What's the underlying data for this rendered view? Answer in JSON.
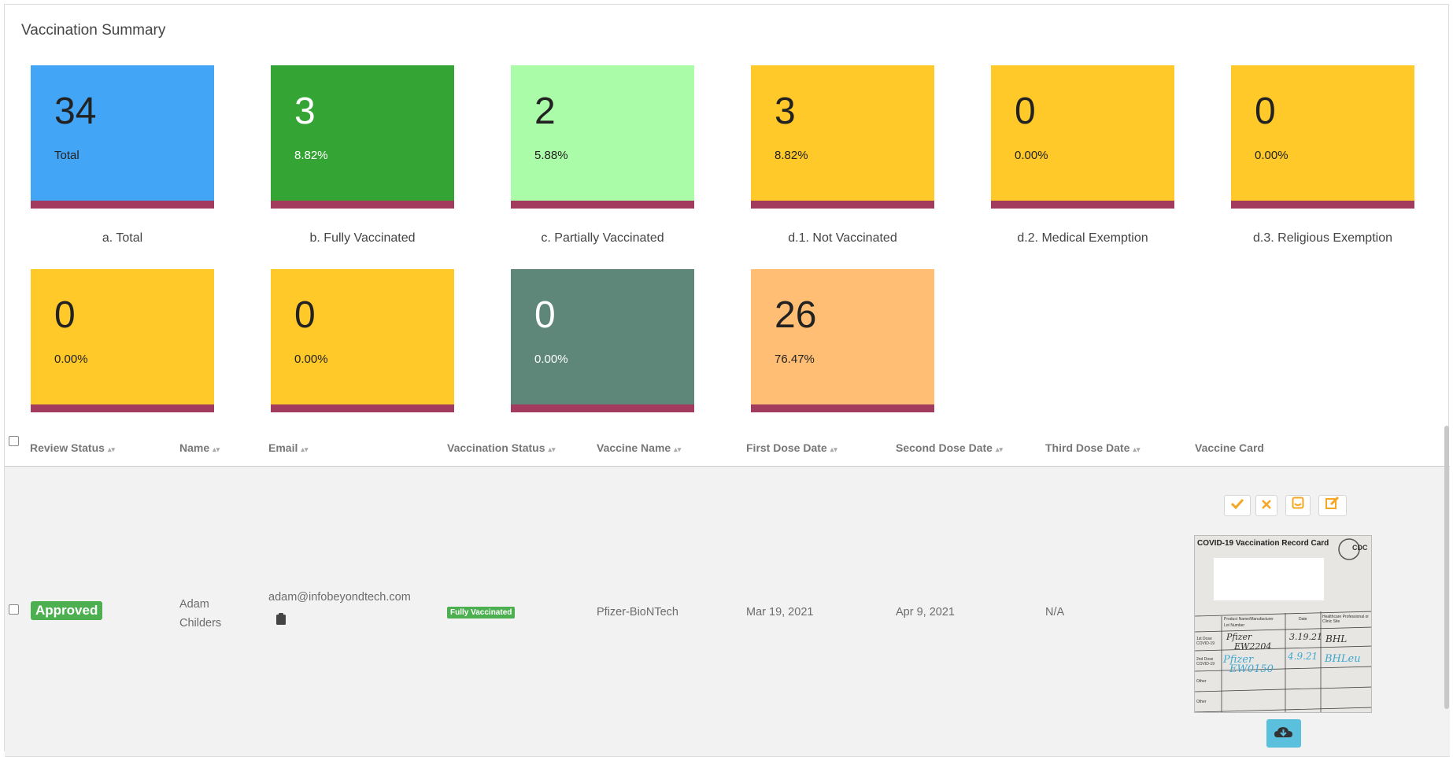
{
  "summary": {
    "title": "Vaccination Summary",
    "tiles": [
      {
        "number": "34",
        "sub": "Total",
        "label": "a.  Total",
        "color": "#42a5f5",
        "text_color": "#222222"
      },
      {
        "number": "3",
        "sub": "8.82%",
        "label": "b.  Fully Vaccinated",
        "color": "#34a534",
        "text_color": "#ffffff"
      },
      {
        "number": "2",
        "sub": "5.88%",
        "label": "c.  Partially Vaccinated",
        "color": "#abfca8",
        "text_color": "#222222"
      },
      {
        "number": "3",
        "sub": "8.82%",
        "label": "d.1.  Not Vaccinated",
        "color": "#ffc929",
        "text_color": "#222222"
      },
      {
        "number": "0",
        "sub": "0.00%",
        "label": "d.2.  Medical Exemption",
        "color": "#ffc929",
        "text_color": "#222222"
      },
      {
        "number": "0",
        "sub": "0.00%",
        "label": "d.3.  Religious Exemption",
        "color": "#ffc929",
        "text_color": "#222222"
      },
      {
        "number": "0",
        "sub": "0.00%",
        "color": "#ffc929",
        "text_color": "#222222"
      },
      {
        "number": "0",
        "sub": "0.00%",
        "color": "#ffc929",
        "text_color": "#222222"
      },
      {
        "number": "0",
        "sub": "0.00%",
        "color": "#5e877a",
        "text_color": "#ffffff"
      },
      {
        "number": "26",
        "sub": "76.47%",
        "color": "#ffbe73",
        "text_color": "#222222"
      }
    ],
    "tile_bar_color": "#a33b5f"
  },
  "table": {
    "headers": [
      "Review Status",
      "Name",
      "Email",
      "Vaccination Status",
      "Vaccine Name",
      "First Dose Date",
      "Second Dose Date",
      "Third Dose Date",
      "Vaccine Card"
    ],
    "row": {
      "review_status": "Approved",
      "name_first": "Adam",
      "name_last": "Childers",
      "email": "adam@infobeyondtech.com",
      "vaccination_status": "Fully Vaccinated",
      "vaccine_name": "Pfizer-BioNTech",
      "first_dose_date": "Mar 19, 2021",
      "second_dose_date": "Apr 9, 2021",
      "third_dose_date": "N/A",
      "card": {
        "title": "COVID-19 Vaccination Record Card",
        "cdc": "CDC",
        "col_product": "Product Name/Manufacturer",
        "col_lot": "Lot Number",
        "col_date": "Date",
        "col_site": "Healthcare Professional or Clinic Site",
        "row1": "1st Dose COVID-19",
        "row2": "2nd Dose COVID-19",
        "row3": "Other",
        "row4": "Other",
        "dose1_product": "Pfizer",
        "dose1_lot": "EW2204",
        "dose1_date": "3.19.21",
        "dose1_site": "BHL",
        "dose2_product": "Pfizer",
        "dose2_lot": "EW0150",
        "dose2_date": "4.9.21",
        "dose2_site": "BHLeu"
      }
    },
    "actions": [
      "approve-icon",
      "reject-icon",
      "message-icon",
      "edit-icon"
    ],
    "download_icon": "cloud-download-icon"
  }
}
